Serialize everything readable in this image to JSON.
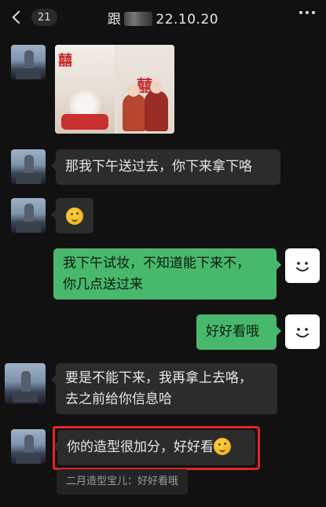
{
  "header": {
    "unread_count": "21",
    "title_prefix": "跟",
    "title_suffix": "22.10.20"
  },
  "messages": {
    "m2": "那我下午送过去，你下来拿下咯",
    "m4_line1": "我下午试妆，不知道能下来不，",
    "m4_line2": "你几点送过来",
    "m5": "好好看哦",
    "m6_line1": "要是不能下来，我再拿上去咯，",
    "m6_line2": "去之前给你信息哈",
    "m7": "你的造型很加分，好好看"
  },
  "photo": {
    "xi_char": "囍"
  },
  "quote": {
    "text": "二月造型宝儿：好好看哦"
  },
  "colors": {
    "background": "#111111",
    "incoming_bubble": "#2c2c2c",
    "outgoing_bubble": "#48b96c",
    "highlight": "#e3242b"
  }
}
